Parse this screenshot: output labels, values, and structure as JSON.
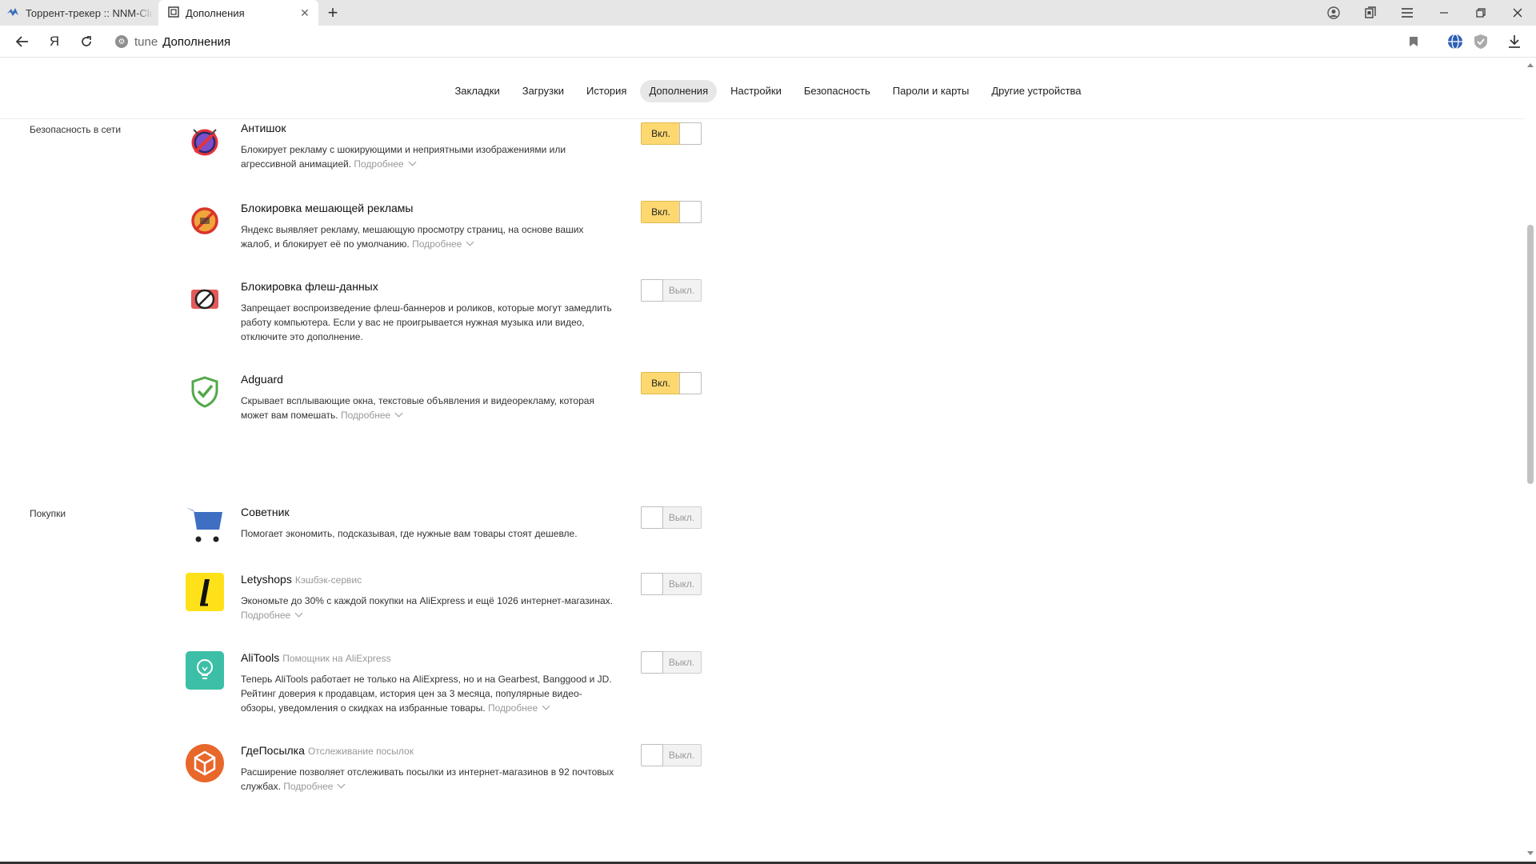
{
  "tabs": [
    {
      "title": "Торрент-трекер :: NNM-Club",
      "active": false
    },
    {
      "title": "Дополнения",
      "active": true
    }
  ],
  "omnibox": {
    "protocol": "tune",
    "text": "Дополнения"
  },
  "settings_nav": [
    "Закладки",
    "Загрузки",
    "История",
    "Дополнения",
    "Настройки",
    "Безопасность",
    "Пароли и карты",
    "Другие устройства"
  ],
  "settings_nav_active": "Дополнения",
  "sections": [
    {
      "title": "Безопасность в сети",
      "extensions": [
        {
          "name": "Антишок",
          "subtitle": "",
          "description": "Блокирует рекламу с шокирующими и неприятными изображениями или агрессивной анимацией.",
          "more": "Подробнее",
          "state": "Вкл.",
          "enabled": true,
          "icon": "antishock-icon"
        },
        {
          "name": "Блокировка мешающей рекламы",
          "subtitle": "",
          "description": "Яндекс выявляет рекламу, мешающую просмотру страниц, на основе ваших жалоб, и блокирует её по умолчанию.",
          "more": "Подробнее",
          "state": "Вкл.",
          "enabled": true,
          "icon": "ad-block-icon"
        },
        {
          "name": "Блокировка флеш-данных",
          "subtitle": "",
          "description": "Запрещает воспроизведение флеш-баннеров и роликов, которые могут замедлить работу компьютера. Если у вас не проигрывается нужная музыка или видео, отключите это дополнение.",
          "more": "",
          "state": "Выкл.",
          "enabled": false,
          "icon": "flash-block-icon"
        },
        {
          "name": "Adguard",
          "subtitle": "",
          "description": "Скрывает всплывающие окна, текстовые объявления и видеорекламу, которая может вам помешать.",
          "more": "Подробнее",
          "state": "Вкл.",
          "enabled": true,
          "icon": "adguard-shield-icon"
        }
      ]
    },
    {
      "title": "Покупки",
      "extensions": [
        {
          "name": "Советник",
          "subtitle": "",
          "description": "Помогает экономить, подсказывая, где нужные вам товары стоят дешевле.",
          "more": "",
          "state": "Выкл.",
          "enabled": false,
          "icon": "shopping-cart-icon"
        },
        {
          "name": "Letyshops",
          "subtitle": "Кэшбэк-сервис",
          "description": "Экономьте до 30% с каждой покупки на AliExpress и ещё 1026 интернет-магазинах.",
          "more": "Подробнее",
          "state": "Выкл.",
          "enabled": false,
          "icon": "letyshops-icon"
        },
        {
          "name": "AliTools",
          "subtitle": "Помощник на AliExpress",
          "description": "Теперь AliTools работает не только на AliExpress, но и на Gearbest, Banggood и JD. Рейтинг доверия к продавцам, история цен за 3 месяца, популярные видео-обзоры, уведомления о скидках на избранные товары.",
          "more": "Подробнее",
          "state": "Выкл.",
          "enabled": false,
          "icon": "alitools-lightbulb-icon"
        },
        {
          "name": "ГдеПосылка",
          "subtitle": "Отслеживание посылок",
          "description": "Расширение позволяет отслеживать посылки из интернет-магазинов в 92 почтовых службах.",
          "more": "Подробнее",
          "state": "Выкл.",
          "enabled": false,
          "icon": "parcel-box-icon"
        }
      ]
    }
  ],
  "colors": {
    "toggle_on": "#fdd870",
    "toggle_off": "#f2f2f2",
    "muted_text": "#999999"
  }
}
